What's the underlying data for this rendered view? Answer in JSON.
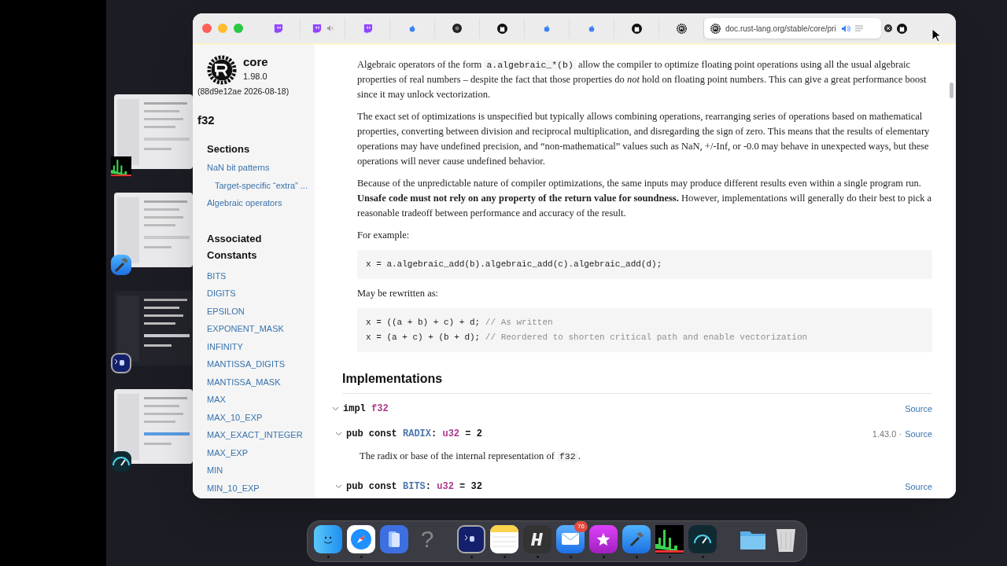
{
  "browser": {
    "tabs": [
      {
        "kind": "twitch",
        "selected": false,
        "audio": false,
        "close_button": false
      },
      {
        "kind": "twitch",
        "selected": false,
        "audio": true,
        "close_button": false
      },
      {
        "kind": "twitch",
        "selected": false,
        "audio": false,
        "close_button": false
      },
      {
        "kind": "apple",
        "selected": false,
        "audio": false,
        "close_button": false
      },
      {
        "kind": "dark",
        "selected": false,
        "audio": false,
        "close_button": false
      },
      {
        "kind": "github",
        "selected": false,
        "audio": false,
        "close_button": false
      },
      {
        "kind": "apple",
        "selected": false,
        "audio": false,
        "close_button": false
      },
      {
        "kind": "apple",
        "selected": false,
        "audio": false,
        "close_button": false
      },
      {
        "kind": "github",
        "selected": false,
        "audio": false,
        "close_button": false
      },
      {
        "kind": "rust",
        "selected": false,
        "audio": false,
        "close_button": false
      },
      {
        "kind": "rust",
        "selected": true,
        "audio": true,
        "close_button": false,
        "url": "doc.rust-lang.org/stable/core/pri"
      },
      {
        "kind": "github",
        "selected": false,
        "audio": false,
        "close_button": true
      }
    ]
  },
  "sidebar": {
    "crate": "core",
    "version": "1.98.0",
    "build": "(88d9e12ae 2026-08-18)",
    "title": "f32",
    "sections_heading": "Sections",
    "sections": [
      {
        "label": "NaN bit patterns",
        "children": [
          {
            "label": "Target-specific “extra” ..."
          }
        ]
      },
      {
        "label": "Algebraic operators"
      }
    ],
    "constants_heading": "Associated Constants",
    "constants": [
      "BITS",
      "DIGITS",
      "EPSILON",
      "EXPONENT_MASK",
      "INFINITY",
      "MANTISSA_DIGITS",
      "MANTISSA_MASK",
      "MAX",
      "MAX_10_EXP",
      "MAX_EXACT_INTEGER",
      "MAX_EXP",
      "MIN",
      "MIN_10_EXP"
    ]
  },
  "content": {
    "blocks": [
      {
        "kind": "paragraph",
        "parts": [
          {
            "kind": "text",
            "text": "Algebraic operators of the form "
          },
          {
            "kind": "code",
            "text": "a.algebraic_*(b)"
          },
          {
            "kind": "text",
            "text": " allow the compiler to optimize floating point operations using all the usual algebraic properties of real numbers – despite the fact that those properties do *not* hold on floating point numbers. This can give a great performance boost since it may unlock vectorization."
          }
        ]
      },
      {
        "kind": "paragraph",
        "parts": [
          {
            "kind": "text",
            "text": "The exact set of optimizations is unspecified but typically allows combining operations, rearranging series of operations based on mathematical properties, converting between division and reciprocal multiplication, and disregarding the sign of zero. This means that the results of elementary operations may have undefined precision, and “non-mathematical” values such as NaN, +/-Inf, or -0.0 may behave in unexpected ways, but these operations will never cause undefined behavior."
          }
        ]
      },
      {
        "kind": "paragraph",
        "parts": [
          {
            "kind": "text",
            "text": "Because of the unpredictable nature of compiler optimizations, the same inputs may produce different results even within a single program run. **Unsafe code must not rely on any property of the return value for soundness.** However, implementations will generally do their best to pick a reasonable tradeoff between performance and accuracy of the result."
          }
        ]
      },
      {
        "kind": "paragraph",
        "parts": [
          {
            "kind": "text",
            "text": "For example:"
          }
        ]
      },
      {
        "kind": "code_block",
        "lines": [
          {
            "code": "x = a.algebraic_add(b).algebraic_add(c).algebraic_add(d);"
          }
        ]
      },
      {
        "kind": "paragraph",
        "parts": [
          {
            "kind": "text",
            "text": "May be rewritten as:"
          }
        ]
      },
      {
        "kind": "code_block",
        "lines": [
          {
            "code": "x = ((a + b) + c) + d;",
            "comment": "// As written"
          },
          {
            "code": "x = (a + c) + (b + d);",
            "comment": "// Reordered to shorten critical path and enable vectorization"
          }
        ]
      }
    ],
    "implementations_heading": "Implementations",
    "impl": {
      "keyword": "impl",
      "type": "f32",
      "source": "Source",
      "expanded": true
    },
    "items": [
      {
        "expanded": true,
        "keyword": "pub const",
        "name": "RADIX",
        "separator": ":",
        "type": "u32",
        "value": "= 2",
        "since": "1.43.0 ·",
        "source": "Source",
        "doc": "The radix or base of the internal representation of ",
        "doc_code": "f32",
        "doc_end": "."
      },
      {
        "expanded": true,
        "keyword": "pub const",
        "name": "BITS",
        "separator": ":",
        "type": "u32",
        "value": "= 32",
        "source": "Source"
      }
    ]
  },
  "stage_manager": [
    {
      "kind": "activity"
    },
    {
      "kind": "xcode"
    },
    {
      "kind": "terminal"
    },
    {
      "kind": "instruments"
    }
  ],
  "dock": {
    "apps": [
      {
        "kind": "finder",
        "running": true
      },
      {
        "kind": "safari",
        "running": true
      },
      {
        "kind": "simulator",
        "running": false
      },
      {
        "kind": "help",
        "label": "?",
        "running": false
      },
      {
        "kind": "terminal",
        "running": true
      },
      {
        "kind": "notes",
        "running": true
      },
      {
        "kind": "h",
        "running": true
      },
      {
        "kind": "mail",
        "running": true,
        "badge": "76"
      },
      {
        "kind": "star",
        "running": true
      },
      {
        "kind": "xcode",
        "running": true
      },
      {
        "kind": "activity",
        "running": true
      },
      {
        "kind": "instruments",
        "running": true
      }
    ],
    "others": [
      {
        "kind": "folder"
      },
      {
        "kind": "trash"
      }
    ]
  }
}
